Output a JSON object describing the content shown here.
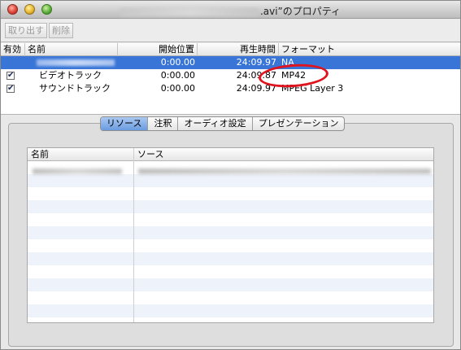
{
  "window": {
    "title_suffix": ".avi”のプロパティ",
    "controls": {
      "close": "close-icon",
      "minimize": "minimize-icon",
      "zoom": "zoom-icon"
    }
  },
  "toolbar": {
    "extract_label": "取り出す",
    "delete_label": "削除"
  },
  "tracks": {
    "columns": {
      "enabled": "有効",
      "name": "名前",
      "start": "開始位置",
      "duration": "再生時間",
      "format": "フォーマット"
    },
    "rows": [
      {
        "name": "",
        "enabled": false,
        "start": "0:00.00",
        "duration": "24:09.97",
        "format": "NA",
        "selected": true
      },
      {
        "name": "ビデオトラック",
        "enabled": true,
        "start": "0:00.00",
        "duration": "24:09.87",
        "format": "MP42",
        "selected": false
      },
      {
        "name": "サウンドトラック",
        "enabled": true,
        "start": "0:00.00",
        "duration": "24:09.97",
        "format": "MPEG Layer 3",
        "selected": false
      }
    ]
  },
  "tabs": [
    {
      "label": "リソース",
      "active": true
    },
    {
      "label": "注釈",
      "active": false
    },
    {
      "label": "オーディオ設定",
      "active": false
    },
    {
      "label": "プレゼンテーション",
      "active": false
    }
  ],
  "resources": {
    "columns": {
      "name": "名前",
      "source": "ソース"
    }
  },
  "colors": {
    "selection": "#3875d7",
    "annotation_ring": "#e0141e"
  }
}
